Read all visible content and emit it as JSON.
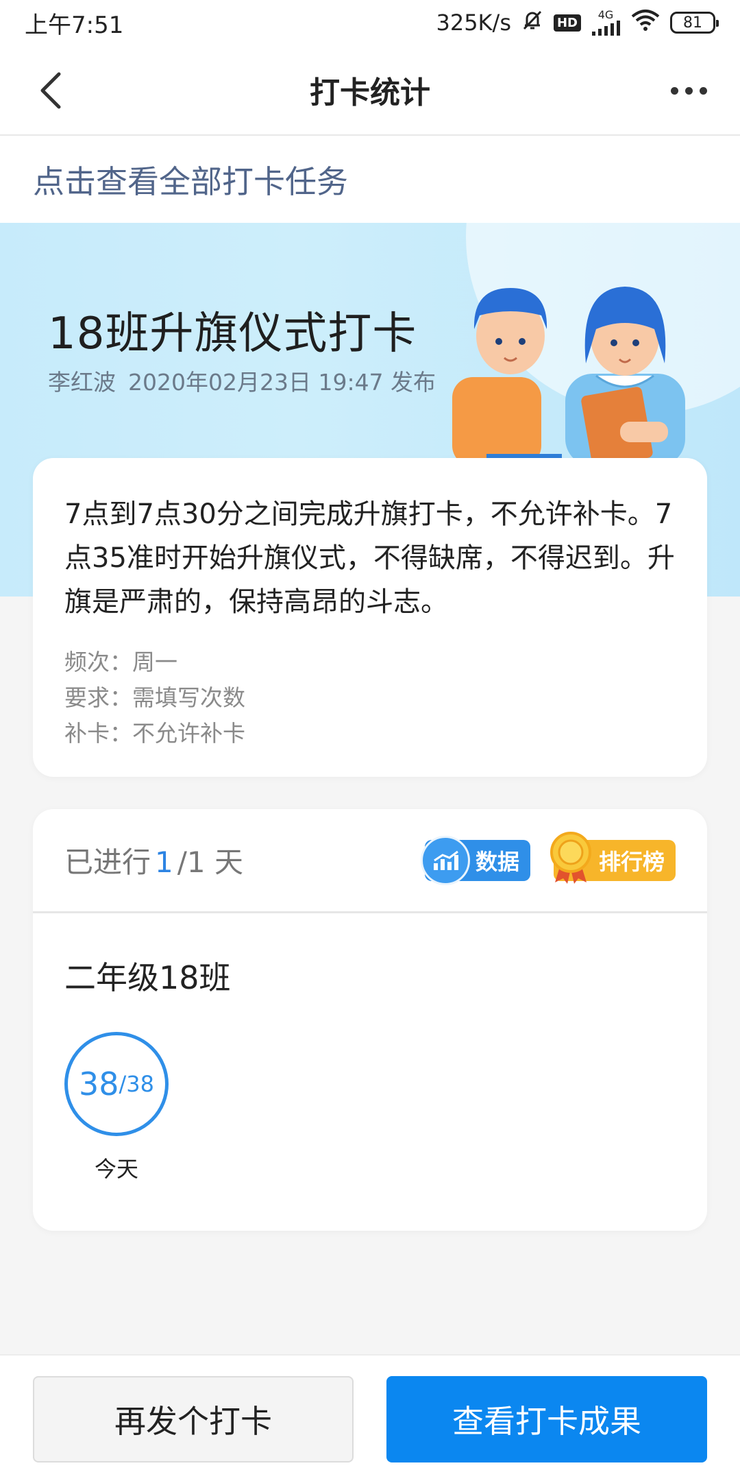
{
  "status": {
    "time": "上午7:51",
    "net_speed": "325K/s",
    "hd": "HD",
    "network": "4G",
    "battery": "81"
  },
  "header": {
    "title": "打卡统计"
  },
  "link": {
    "text": "点击查看全部打卡任务"
  },
  "task": {
    "title": "18班升旗仪式打卡",
    "publisher": "李红波",
    "published_at": "2020年02月23日 19:47 发布",
    "description": "7点到7点30分之间完成升旗打卡，不允许补卡。7点35准时开始升旗仪式，不得缺席，不得迟到。升旗是严肃的，保持高昂的斗志。",
    "attrs": {
      "frequency": "频次：周一",
      "requirement": "要求：需填写次数",
      "makeup": "补卡：不允许补卡"
    }
  },
  "stats": {
    "progress_prefix": "已进行",
    "progress_current": "1",
    "progress_total": "/1 天",
    "data_button": "数据",
    "rank_button": "排行榜",
    "class_name": "二年级18班",
    "ring_done": "38",
    "ring_total": "/38",
    "ring_label": "今天"
  },
  "bottom": {
    "again_label": "再发个打卡",
    "result_label": "查看打卡成果"
  },
  "colors": {
    "primary": "#0b87f0",
    "accent_blue": "#2f8fe8",
    "gold": "#f7b52a",
    "banner_bg": "#c7ebfb"
  },
  "icons": [
    "back-arrow-icon",
    "more-dots-icon",
    "mute-bell-icon",
    "signal-icon",
    "wifi-icon",
    "battery-icon",
    "chart-icon",
    "medal-icon"
  ]
}
